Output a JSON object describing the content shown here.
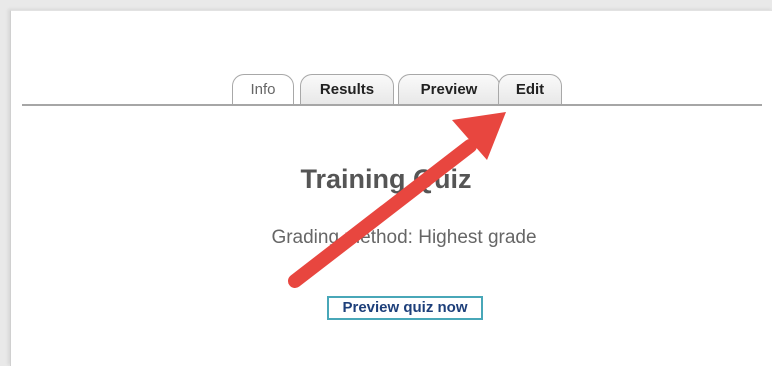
{
  "tabs": {
    "info": "Info",
    "results": "Results",
    "preview": "Preview",
    "edit": "Edit"
  },
  "quiz": {
    "title": "Training Quiz",
    "grading_method": "Grading method: Highest grade"
  },
  "actions": {
    "preview_now": "Preview quiz now"
  },
  "annotation": {
    "arrow_color": "#e8463f"
  }
}
